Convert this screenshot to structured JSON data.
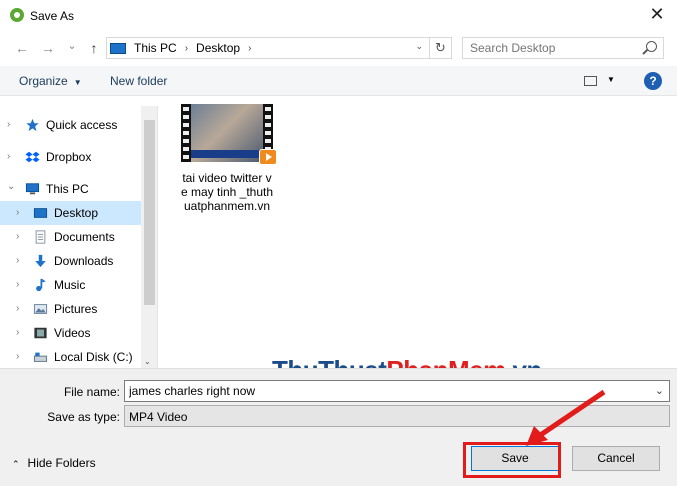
{
  "window": {
    "title": "Save As",
    "close_glyph": "✕"
  },
  "nav": {
    "back_glyph": "←",
    "forward_glyph": "→",
    "dropdown_glyph": "⌄",
    "up_glyph": "↑",
    "breadcrumb": [
      "This PC",
      "Desktop"
    ],
    "crumb_separator": "›",
    "refresh_glyph": "↻",
    "search_placeholder": "Search Desktop"
  },
  "toolbar": {
    "organize_label": "Organize",
    "new_folder_label": "New folder",
    "help_glyph": "?",
    "caret": "▼"
  },
  "sidebar": {
    "chevron": "›",
    "chevron_open": "⌄",
    "items": [
      {
        "label": "Quick access",
        "icon": "star-icon",
        "color": "#1e73c8"
      },
      {
        "label": "Dropbox",
        "icon": "dropbox-icon",
        "color": "#0061fe"
      },
      {
        "label": "This PC",
        "icon": "computer-icon",
        "color": "#1e73c8"
      },
      {
        "label": "Desktop",
        "icon": "desktop-icon",
        "color": "#1e73c8",
        "selected": true
      },
      {
        "label": "Documents",
        "icon": "documents-icon",
        "color": "#7a8a9a"
      },
      {
        "label": "Downloads",
        "icon": "downloads-icon",
        "color": "#1e73c8"
      },
      {
        "label": "Music",
        "icon": "music-icon",
        "color": "#1e73c8"
      },
      {
        "label": "Pictures",
        "icon": "pictures-icon",
        "color": "#5a7a9a"
      },
      {
        "label": "Videos",
        "icon": "videos-icon",
        "color": "#333333"
      },
      {
        "label": "Local Disk (C:)",
        "icon": "disk-icon",
        "color": "#5a6a7a"
      }
    ],
    "scroll_down_glyph": "⌄"
  },
  "files": [
    {
      "name": "tai video twitter ve may tinh _thuthuatphanmem.vn",
      "icon": "video-file-icon"
    }
  ],
  "watermark": {
    "part1": "ThuThuat",
    "part2": "PhanMem",
    "part3": ".vn"
  },
  "form": {
    "file_name_label": "File name:",
    "file_name_value": "james charles right now",
    "save_type_label": "Save as type:",
    "save_type_value": "MP4 Video",
    "caret": "⌄"
  },
  "footer": {
    "hide_folders_label": "Hide Folders",
    "hide_caret": "⌃",
    "save_label": "Save",
    "cancel_label": "Cancel"
  },
  "colors": {
    "highlight_red": "#e21b1b",
    "selection_blue": "#cce8ff"
  }
}
